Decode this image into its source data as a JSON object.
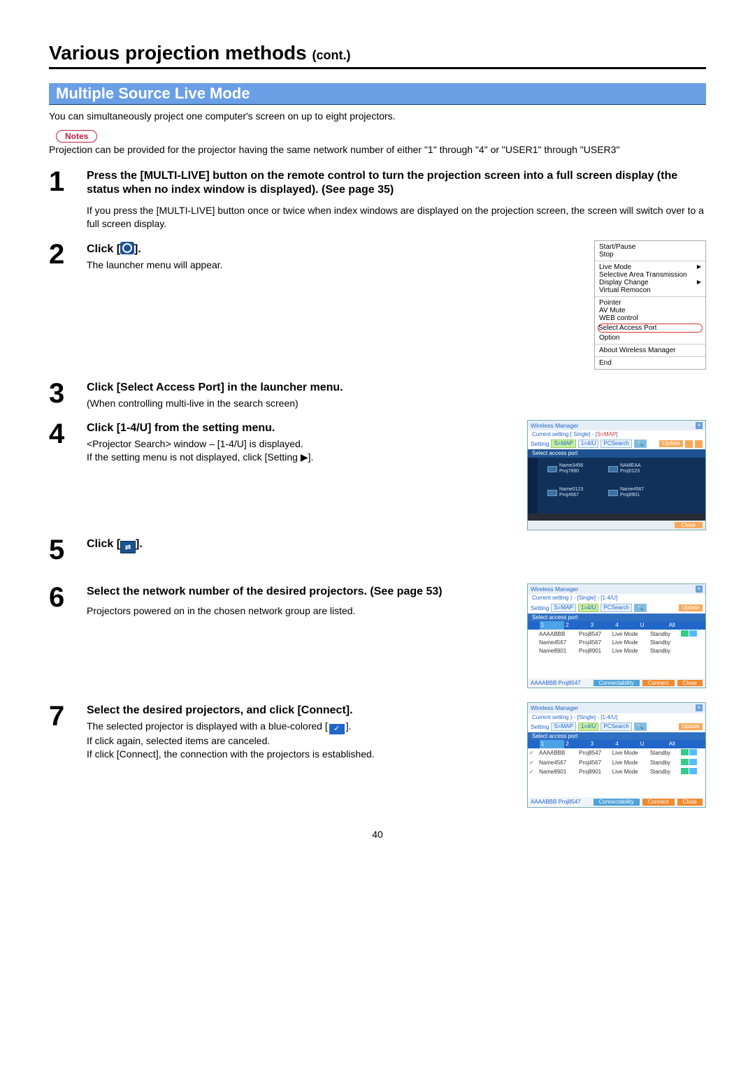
{
  "page": {
    "title": "Various projection methods ",
    "cont": "(cont.)",
    "section": "Multiple Source Live Mode",
    "intro": "You can simultaneously project one computer's screen on up to eight projectors.",
    "notes_label": "Notes",
    "notes_text": "Projection can be provided for the projector having the same network number of either \"1\" through \"4\" or \"USER1\" through \"USER3\"",
    "page_number": "40"
  },
  "steps": [
    {
      "num": "1",
      "heading": "Press the [MULTI-LIVE] button on the remote control to turn the projection screen into a full screen display (the status when no index window is displayed). (See page 35)",
      "detail": "If you press the [MULTI-LIVE] button once or twice when index windows are displayed on the projection screen, the screen will switch over to a full screen display."
    },
    {
      "num": "2",
      "heading_prefix": "Click [",
      "heading_suffix": "].",
      "detail": "The launcher menu will appear."
    },
    {
      "num": "3",
      "heading": "Click [Select Access Port] in the launcher menu.",
      "detail": "(When controlling multi-live in the search screen)"
    },
    {
      "num": "4",
      "heading": "Click [1-4/U] from the setting menu.",
      "detail": "<Projector Search> window – [1-4/U] is displayed.\nIf the setting menu is not displayed, click [Setting ▶]."
    },
    {
      "num": "5",
      "heading_prefix": "Click [",
      "heading_suffix": "]."
    },
    {
      "num": "6",
      "heading": "Select the network number of the desired projectors. (See page 53)",
      "detail": "Projectors powered on in the chosen network group are listed."
    },
    {
      "num": "7",
      "heading": "Select the desired projectors, and click [Connect].",
      "detail_parts": {
        "a": "The selected projector is displayed with a blue-colored [",
        "b": "].",
        "c": "If click again, selected items are canceled.",
        "d": "If click [Connect], the connection with the projectors is established."
      }
    }
  ],
  "launcher_menu": {
    "sec1": [
      "Start/Pause",
      "Stop"
    ],
    "sec2": [
      {
        "label": "Live Mode",
        "arrow": true
      },
      {
        "label": "Selective Area Transmission"
      },
      {
        "label": "Display Change",
        "arrow": true
      },
      {
        "label": "Virtual Remocon"
      }
    ],
    "sec3": [
      "Pointer",
      "AV Mute",
      "WEB control"
    ],
    "highlight": "Select Access Port",
    "sec4": [
      "Option"
    ],
    "sec5": [
      "About Wireless Manager"
    ],
    "sec6": [
      "End"
    ]
  },
  "wm": {
    "title": "Wireless Manager",
    "subtitle_a": "Current setting [ Single] - [",
    "subtitle_b": "S=MAP",
    "subtitle_c": "]",
    "subtitle2": "Current setting ) - [Single] - [1-4/U]",
    "toolbar": {
      "setting": "Setting",
      "smap": "S=MAP",
      "range": "1=4/U",
      "pcsearch": "PCSearch",
      "update": "Update"
    },
    "bar_select": "Select access port",
    "bar_select2": "Select access port",
    "proj_icons": [
      {
        "l1": "Name3456",
        "l2": "Proj7890"
      },
      {
        "l1": "NAMEAA",
        "l2": "Proj0123"
      },
      {
        "l1": "Name0123",
        "l2": "Proj4567"
      },
      {
        "l1": "Name4567",
        "l2": "Proj8901"
      }
    ],
    "close": "Close",
    "footer_label": "AAAABBB Proj8547",
    "footer_btns": {
      "a": "Connectability",
      "b": "Connect",
      "c": "Close"
    },
    "table_head": [
      "",
      "1",
      "2",
      "3",
      "4",
      "U",
      "All"
    ],
    "rows6": [
      {
        "check": false,
        "name": "AAAABBB",
        "id": "Proj8547",
        "mode": "Live Mode",
        "status": "Standby",
        "act": true
      },
      {
        "check": false,
        "name": "Name4567",
        "id": "Proj4567",
        "mode": "Live Mode",
        "status": "Standby"
      },
      {
        "check": false,
        "name": "Name8901",
        "id": "Proj8901",
        "mode": "Live Mode",
        "status": "Standby"
      }
    ],
    "rows7": [
      {
        "check": true,
        "name": "AAAABBB",
        "id": "Proj8547",
        "mode": "Live Mode",
        "status": "Standby",
        "act": true
      },
      {
        "check": true,
        "name": "Name4567",
        "id": "Proj4567",
        "mode": "Live Mode",
        "status": "Standby",
        "act": true
      },
      {
        "check": true,
        "name": "Name8901",
        "id": "Proj8901",
        "mode": "Live Mode",
        "status": "Standby",
        "act": true
      }
    ]
  }
}
